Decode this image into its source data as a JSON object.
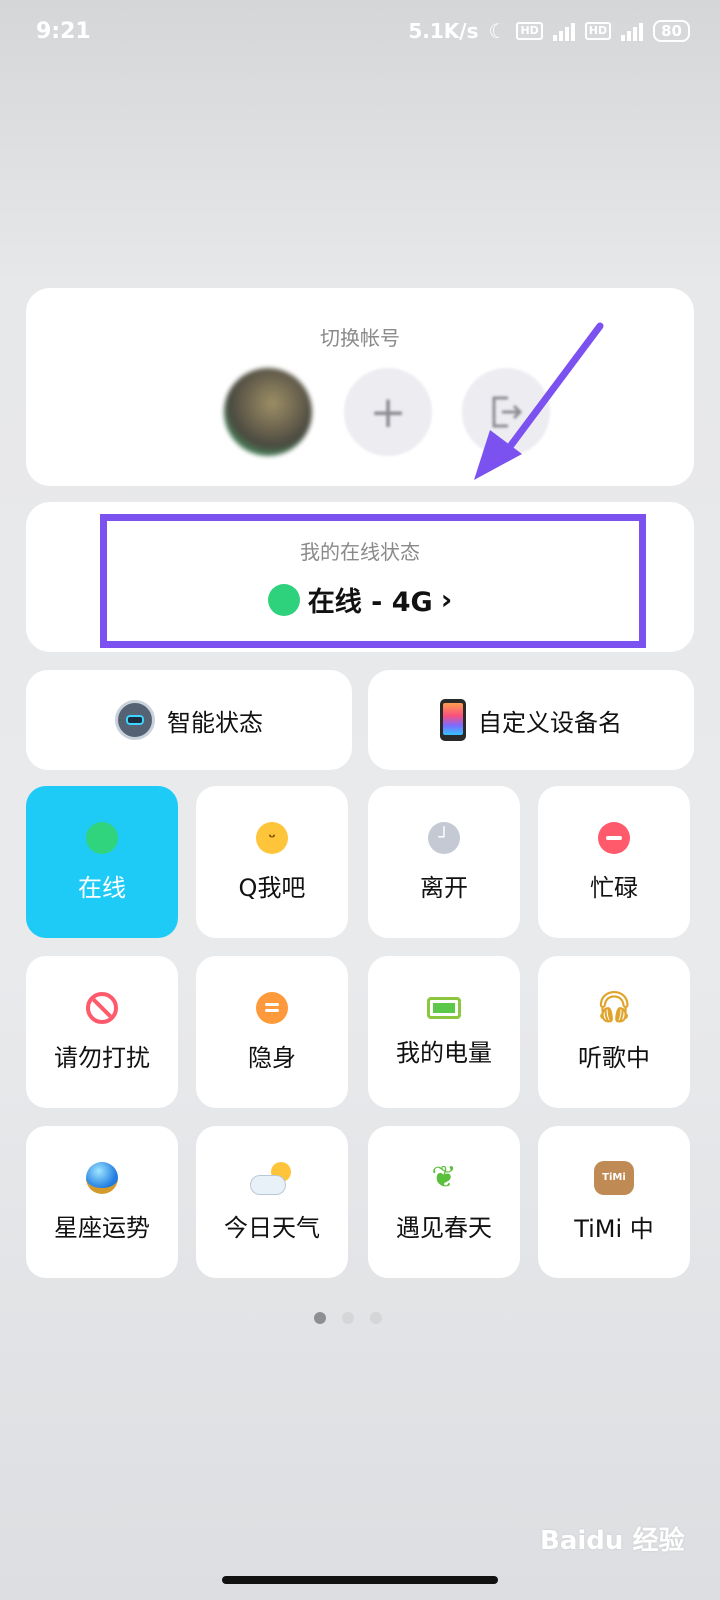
{
  "status_bar": {
    "time": "9:21",
    "net_speed": "5.1K/s",
    "battery": "80"
  },
  "account": {
    "title": "切换帐号",
    "add_icon": "+",
    "exit_icon": "⇥"
  },
  "online_status": {
    "label": "我的在线状态",
    "value": "在线 - 4G",
    "chevron": "›"
  },
  "actions": {
    "smart_status": "智能状态",
    "custom_device": "自定义设备名"
  },
  "tiles": [
    {
      "label": "在线",
      "icon": "online-dot-icon",
      "active": true
    },
    {
      "label": "Q我吧",
      "icon": "smile-icon",
      "active": false
    },
    {
      "label": "离开",
      "icon": "clock-icon",
      "active": false
    },
    {
      "label": "忙碌",
      "icon": "busy-icon",
      "active": false
    },
    {
      "label": "请勿打扰",
      "icon": "no-disturb-icon",
      "active": false
    },
    {
      "label": "隐身",
      "icon": "invisible-icon",
      "active": false
    },
    {
      "label": "我的电量",
      "icon": "battery-icon",
      "active": false
    },
    {
      "label": "听歌中",
      "icon": "headphones-icon",
      "active": false
    },
    {
      "label": "星座运势",
      "icon": "crystal-ball-icon",
      "active": false
    },
    {
      "label": "今日天气",
      "icon": "weather-icon",
      "active": false
    },
    {
      "label": "遇见春天",
      "icon": "sprout-icon",
      "active": false
    },
    {
      "label": "TiMi 中",
      "icon": "timi-icon",
      "active": false
    }
  ],
  "timi_badge": "TiMi",
  "watermark": "Baidu 经验",
  "colors": {
    "accent": "#1ecbf6",
    "online_green": "#2fd27c",
    "highlight": "#7b52f0"
  }
}
